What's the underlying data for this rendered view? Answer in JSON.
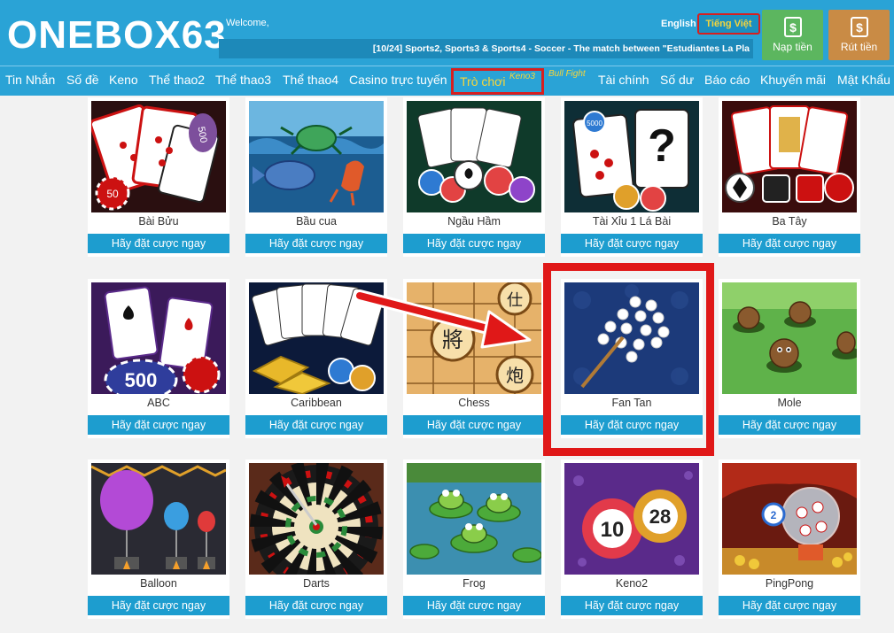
{
  "header": {
    "logo": "ONEBOX63",
    "welcome": "Welcome,",
    "lang_en": "English",
    "lang_vi": "Tiếng Việt",
    "ticker": "[10/24] Sports2, Sports3 & Sports4 - Soccer - The match between \"Estudiantes La Pla",
    "deposit": "Nạp tiền",
    "withdraw": "Rút tiền"
  },
  "nav": {
    "items": [
      "Tin Nhắn",
      "Số đề",
      "Keno",
      "Thể thao2",
      "Thể thao3",
      "Thể thao4",
      "Casino trực tuyến",
      "Tài chính",
      "Số dư",
      "Báo cáo",
      "Khuyến mãi",
      "Mật Khẩu"
    ],
    "games": "Trò chơi",
    "games_badge": "Keno3",
    "bull": "Bull Fight"
  },
  "games": [
    {
      "name": "Bài Bửu",
      "cta": "Hãy đặt cược ngay"
    },
    {
      "name": "Bầu cua",
      "cta": "Hãy đặt cược ngay"
    },
    {
      "name": "Ngầu Hầm",
      "cta": "Hãy đặt cược ngay"
    },
    {
      "name": "Tài Xỉu 1 Lá Bài",
      "cta": "Hãy đặt cược ngay"
    },
    {
      "name": "Ba Tây",
      "cta": "Hãy đặt cược ngay"
    },
    {
      "name": "ABC",
      "cta": "Hãy đặt cược ngay"
    },
    {
      "name": "Caribbean",
      "cta": "Hãy đặt cược ngay"
    },
    {
      "name": "Chess",
      "cta": "Hãy đặt cược ngay"
    },
    {
      "name": "Fan Tan",
      "cta": "Hãy đặt cược ngay"
    },
    {
      "name": "Mole",
      "cta": "Hãy đặt cược ngay"
    },
    {
      "name": "Balloon",
      "cta": "Hãy đặt cược ngay"
    },
    {
      "name": "Darts",
      "cta": "Hãy đặt cược ngay"
    },
    {
      "name": "Frog",
      "cta": "Hãy đặt cược ngay"
    },
    {
      "name": "Keno2",
      "cta": "Hãy đặt cược ngay"
    },
    {
      "name": "PingPong",
      "cta": "Hãy đặt cược ngay"
    }
  ],
  "thumb_text": {
    "card_500": "500",
    "card_50": "50",
    "card_5000": "5000",
    "question": "?",
    "chip_500": "500",
    "chess_a": "將",
    "chess_b": "炮",
    "chess_c": "仕",
    "ball_10": "10",
    "ball_28": "28",
    "ball_2": "2"
  },
  "colors": {
    "brand": "#2aa3d6",
    "accent_yellow": "#f6d53b",
    "highlight_red": "#e01818",
    "button_blue": "#1d9dcf",
    "deposit_green": "#5cb65f",
    "withdraw_orange": "#c98b45"
  }
}
